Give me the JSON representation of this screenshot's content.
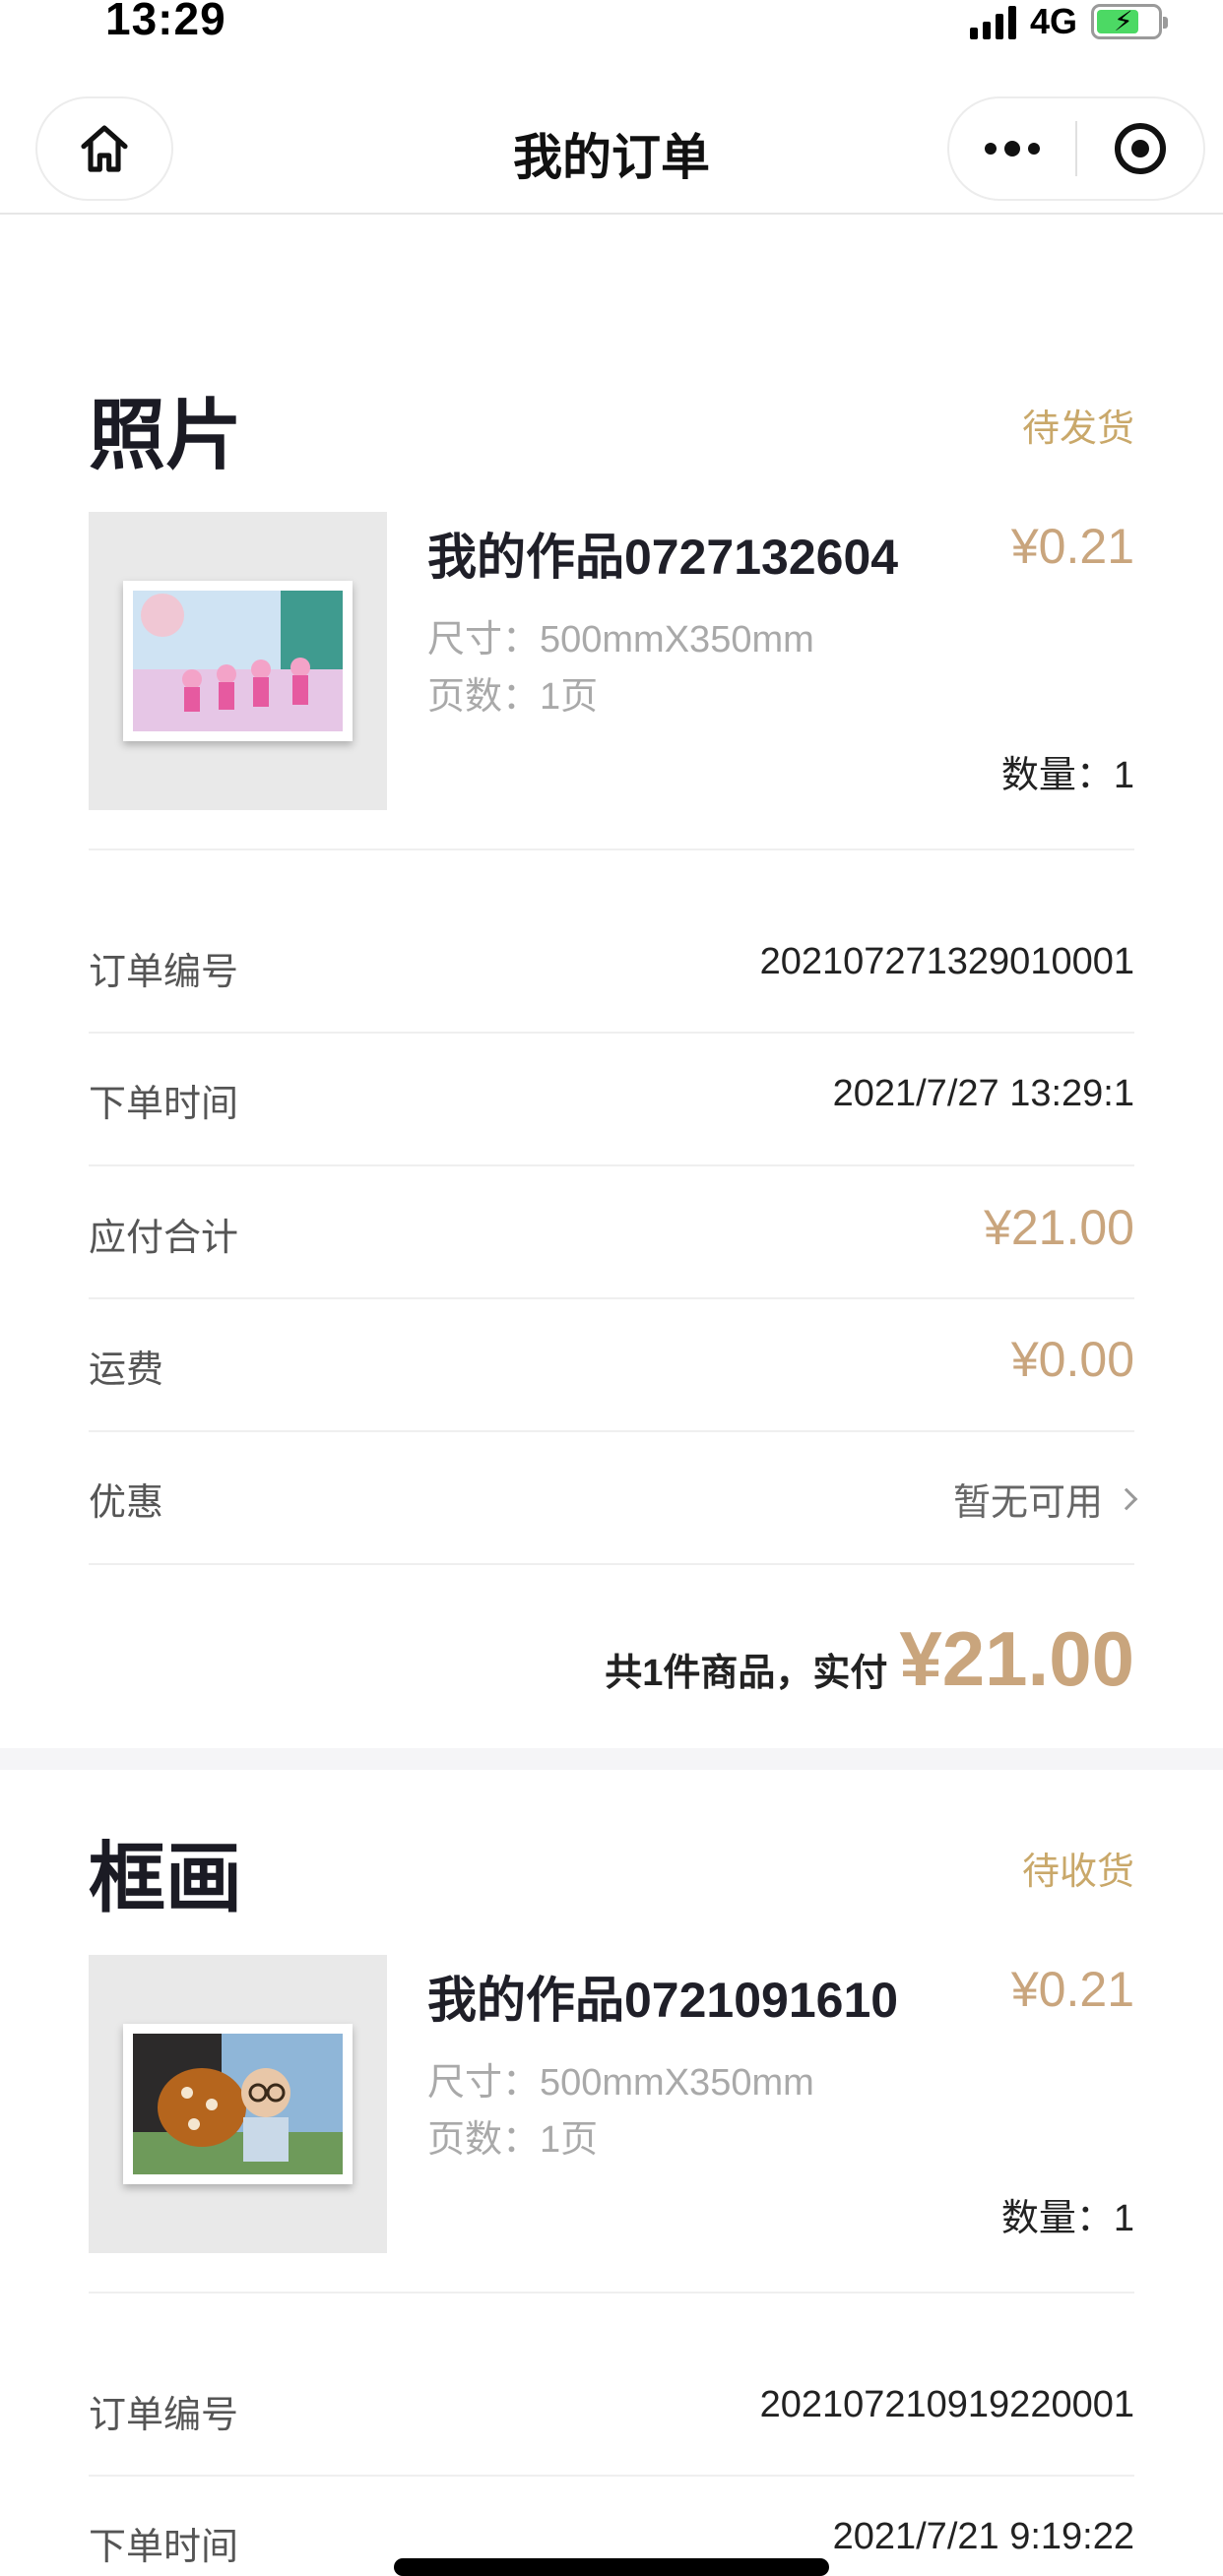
{
  "status_bar": {
    "time": "13:29",
    "network": "4G"
  },
  "nav": {
    "title": "我的订单",
    "home_icon": "home-icon",
    "more_icon": "more-dots-icon",
    "close_icon": "target-icon"
  },
  "orders": [
    {
      "type": "照片",
      "status": "待发货",
      "product": {
        "name": "我的作品0727132604",
        "price": "¥0.21",
        "size": "尺寸：500mmX350mm",
        "pages": "页数：1页",
        "quantity": "数量：1"
      },
      "rows": {
        "order_no": {
          "label": "订单编号",
          "value": "202107271329010001"
        },
        "order_time": {
          "label": "下单时间",
          "value": "2021/7/27 13:29:1"
        },
        "payable": {
          "label": "应付合计",
          "value": "¥21.00"
        },
        "shipping": {
          "label": "运费",
          "value": "¥0.00"
        },
        "discount": {
          "label": "优惠",
          "value": "暂无可用"
        }
      },
      "total": {
        "text": "共1件商品，实付",
        "amount": "¥21.00"
      }
    },
    {
      "type": "框画",
      "status": "待收货",
      "product": {
        "name": "我的作品0721091610",
        "price": "¥0.21",
        "size": "尺寸：500mmX350mm",
        "pages": "页数：1页",
        "quantity": "数量：1"
      },
      "rows": {
        "order_no": {
          "label": "订单编号",
          "value": "202107210919220001"
        },
        "order_time": {
          "label": "下单时间",
          "value": "2021/7/21 9:19:22"
        }
      }
    }
  ],
  "colors": {
    "accent_gold": "#c9a86a",
    "price": "#c9a57d",
    "battery": "#4cd964"
  }
}
